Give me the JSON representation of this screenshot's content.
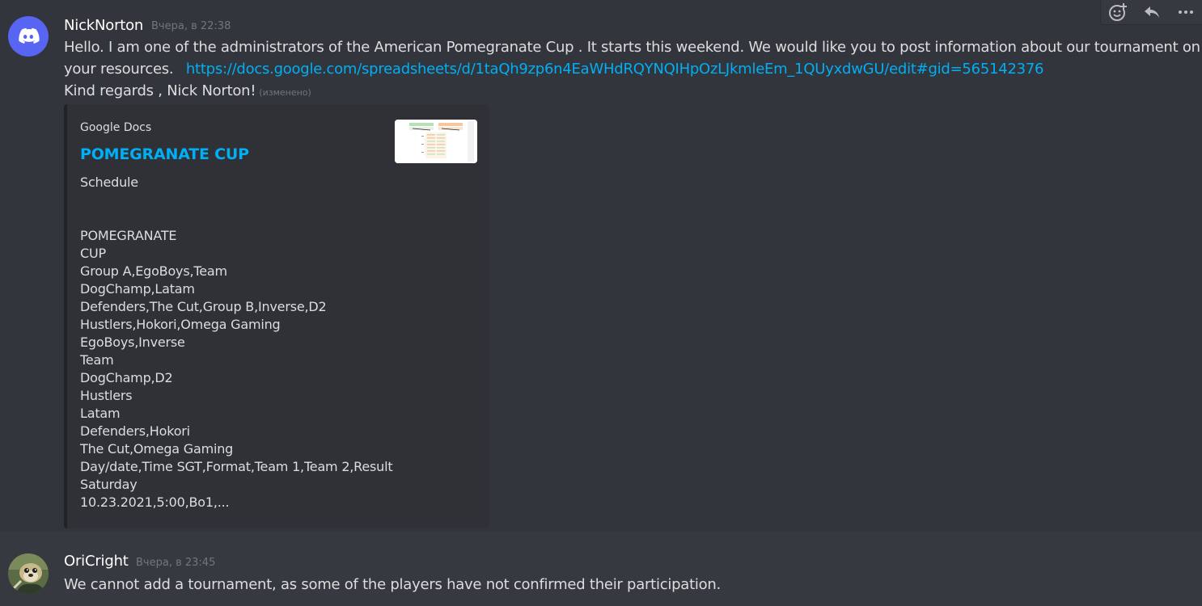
{
  "toolbar": {
    "icons": [
      "add-reaction-icon",
      "reply-icon",
      "more-icon"
    ]
  },
  "messages": [
    {
      "author": "NickNorton",
      "timestamp": "Вчера, в 22:38",
      "line1": "Hello. I am one of the administrators of the American Pomegranate Cup . It starts this weekend. We would like you to post information about our tournament on",
      "line2_text": "your resources.",
      "link": "https://docs.google.com/spreadsheets/d/1taQh9zp6n4EaWHdRQYNQIHpOzLJkmleEm_1QUyxdwGU/edit#gid=565142376",
      "line3": "Kind regards , Nick Norton!",
      "edited": "(изменено)",
      "embed": {
        "provider": "Google Docs",
        "title": "POMEGRANATE CUP",
        "description": "Schedule",
        "lines": [
          "POMEGRANATE",
          "CUP",
          "Group A,EgoBoys,Team",
          "DogChamp,Latam",
          "Defenders,The Cut,Group B,Inverse,D2",
          "Hustlers,Hokori,Omega Gaming",
          "EgoBoys,Inverse",
          "Team",
          "DogChamp,D2",
          "Hustlers",
          "Latam",
          "Defenders,Hokori",
          "The Cut,Omega Gaming",
          "Day/date,Time SGT,Format,Team 1,Team 2,Result",
          "Saturday",
          "10.23.2021,5:00,Bo1,..."
        ]
      }
    },
    {
      "author": "OriCright",
      "timestamp": "Вчера, в 23:45",
      "text": "We cannot add a tournament, as some of the players have not confirmed their participation."
    }
  ],
  "colors": {
    "background": "#36393f",
    "hover_background": "#32353b",
    "link": "#00aff4",
    "embed_background": "#2f3136",
    "discord_blurple": "#5865f2"
  }
}
